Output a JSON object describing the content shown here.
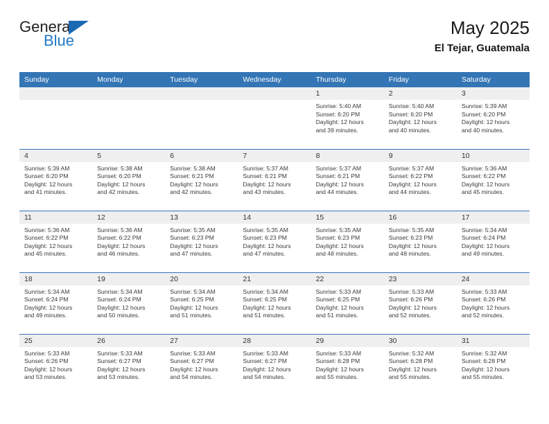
{
  "logo": {
    "word1": "General",
    "word2": "Blue",
    "triangle_color": "#1b69b3",
    "text_color": "#231f20",
    "blue_text_color": "#2079c4"
  },
  "header": {
    "title": "May 2025",
    "location": "El Tejar, Guatemala"
  },
  "theme": {
    "header_blue": "#3375b5",
    "daynum_bg": "#efefef",
    "body_text": "#3a3a3a"
  },
  "weekdays": [
    "Sunday",
    "Monday",
    "Tuesday",
    "Wednesday",
    "Thursday",
    "Friday",
    "Saturday"
  ],
  "weeks": [
    [
      {
        "day": "",
        "empty": true,
        "sunrise": "",
        "sunset": "",
        "daylight1": "",
        "daylight2": ""
      },
      {
        "day": "",
        "empty": true,
        "sunrise": "",
        "sunset": "",
        "daylight1": "",
        "daylight2": ""
      },
      {
        "day": "",
        "empty": true,
        "sunrise": "",
        "sunset": "",
        "daylight1": "",
        "daylight2": ""
      },
      {
        "day": "",
        "empty": true,
        "sunrise": "",
        "sunset": "",
        "daylight1": "",
        "daylight2": ""
      },
      {
        "day": "1",
        "sunrise": "Sunrise: 5:40 AM",
        "sunset": "Sunset: 6:20 PM",
        "daylight1": "Daylight: 12 hours",
        "daylight2": "and 39 minutes."
      },
      {
        "day": "2",
        "sunrise": "Sunrise: 5:40 AM",
        "sunset": "Sunset: 6:20 PM",
        "daylight1": "Daylight: 12 hours",
        "daylight2": "and 40 minutes."
      },
      {
        "day": "3",
        "sunrise": "Sunrise: 5:39 AM",
        "sunset": "Sunset: 6:20 PM",
        "daylight1": "Daylight: 12 hours",
        "daylight2": "and 40 minutes."
      }
    ],
    [
      {
        "day": "4",
        "sunrise": "Sunrise: 5:39 AM",
        "sunset": "Sunset: 6:20 PM",
        "daylight1": "Daylight: 12 hours",
        "daylight2": "and 41 minutes."
      },
      {
        "day": "5",
        "sunrise": "Sunrise: 5:38 AM",
        "sunset": "Sunset: 6:20 PM",
        "daylight1": "Daylight: 12 hours",
        "daylight2": "and 42 minutes."
      },
      {
        "day": "6",
        "sunrise": "Sunrise: 5:38 AM",
        "sunset": "Sunset: 6:21 PM",
        "daylight1": "Daylight: 12 hours",
        "daylight2": "and 42 minutes."
      },
      {
        "day": "7",
        "sunrise": "Sunrise: 5:37 AM",
        "sunset": "Sunset: 6:21 PM",
        "daylight1": "Daylight: 12 hours",
        "daylight2": "and 43 minutes."
      },
      {
        "day": "8",
        "sunrise": "Sunrise: 5:37 AM",
        "sunset": "Sunset: 6:21 PM",
        "daylight1": "Daylight: 12 hours",
        "daylight2": "and 44 minutes."
      },
      {
        "day": "9",
        "sunrise": "Sunrise: 5:37 AM",
        "sunset": "Sunset: 6:22 PM",
        "daylight1": "Daylight: 12 hours",
        "daylight2": "and 44 minutes."
      },
      {
        "day": "10",
        "sunrise": "Sunrise: 5:36 AM",
        "sunset": "Sunset: 6:22 PM",
        "daylight1": "Daylight: 12 hours",
        "daylight2": "and 45 minutes."
      }
    ],
    [
      {
        "day": "11",
        "sunrise": "Sunrise: 5:36 AM",
        "sunset": "Sunset: 6:22 PM",
        "daylight1": "Daylight: 12 hours",
        "daylight2": "and 45 minutes."
      },
      {
        "day": "12",
        "sunrise": "Sunrise: 5:36 AM",
        "sunset": "Sunset: 6:22 PM",
        "daylight1": "Daylight: 12 hours",
        "daylight2": "and 46 minutes."
      },
      {
        "day": "13",
        "sunrise": "Sunrise: 5:35 AM",
        "sunset": "Sunset: 6:23 PM",
        "daylight1": "Daylight: 12 hours",
        "daylight2": "and 47 minutes."
      },
      {
        "day": "14",
        "sunrise": "Sunrise: 5:35 AM",
        "sunset": "Sunset: 6:23 PM",
        "daylight1": "Daylight: 12 hours",
        "daylight2": "and 47 minutes."
      },
      {
        "day": "15",
        "sunrise": "Sunrise: 5:35 AM",
        "sunset": "Sunset: 6:23 PM",
        "daylight1": "Daylight: 12 hours",
        "daylight2": "and 48 minutes."
      },
      {
        "day": "16",
        "sunrise": "Sunrise: 5:35 AM",
        "sunset": "Sunset: 6:23 PM",
        "daylight1": "Daylight: 12 hours",
        "daylight2": "and 48 minutes."
      },
      {
        "day": "17",
        "sunrise": "Sunrise: 5:34 AM",
        "sunset": "Sunset: 6:24 PM",
        "daylight1": "Daylight: 12 hours",
        "daylight2": "and 49 minutes."
      }
    ],
    [
      {
        "day": "18",
        "sunrise": "Sunrise: 5:34 AM",
        "sunset": "Sunset: 6:24 PM",
        "daylight1": "Daylight: 12 hours",
        "daylight2": "and 49 minutes."
      },
      {
        "day": "19",
        "sunrise": "Sunrise: 5:34 AM",
        "sunset": "Sunset: 6:24 PM",
        "daylight1": "Daylight: 12 hours",
        "daylight2": "and 50 minutes."
      },
      {
        "day": "20",
        "sunrise": "Sunrise: 5:34 AM",
        "sunset": "Sunset: 6:25 PM",
        "daylight1": "Daylight: 12 hours",
        "daylight2": "and 51 minutes."
      },
      {
        "day": "21",
        "sunrise": "Sunrise: 5:34 AM",
        "sunset": "Sunset: 6:25 PM",
        "daylight1": "Daylight: 12 hours",
        "daylight2": "and 51 minutes."
      },
      {
        "day": "22",
        "sunrise": "Sunrise: 5:33 AM",
        "sunset": "Sunset: 6:25 PM",
        "daylight1": "Daylight: 12 hours",
        "daylight2": "and 51 minutes."
      },
      {
        "day": "23",
        "sunrise": "Sunrise: 5:33 AM",
        "sunset": "Sunset: 6:26 PM",
        "daylight1": "Daylight: 12 hours",
        "daylight2": "and 52 minutes."
      },
      {
        "day": "24",
        "sunrise": "Sunrise: 5:33 AM",
        "sunset": "Sunset: 6:26 PM",
        "daylight1": "Daylight: 12 hours",
        "daylight2": "and 52 minutes."
      }
    ],
    [
      {
        "day": "25",
        "sunrise": "Sunrise: 5:33 AM",
        "sunset": "Sunset: 6:26 PM",
        "daylight1": "Daylight: 12 hours",
        "daylight2": "and 53 minutes."
      },
      {
        "day": "26",
        "sunrise": "Sunrise: 5:33 AM",
        "sunset": "Sunset: 6:27 PM",
        "daylight1": "Daylight: 12 hours",
        "daylight2": "and 53 minutes."
      },
      {
        "day": "27",
        "sunrise": "Sunrise: 5:33 AM",
        "sunset": "Sunset: 6:27 PM",
        "daylight1": "Daylight: 12 hours",
        "daylight2": "and 54 minutes."
      },
      {
        "day": "28",
        "sunrise": "Sunrise: 5:33 AM",
        "sunset": "Sunset: 6:27 PM",
        "daylight1": "Daylight: 12 hours",
        "daylight2": "and 54 minutes."
      },
      {
        "day": "29",
        "sunrise": "Sunrise: 5:33 AM",
        "sunset": "Sunset: 6:28 PM",
        "daylight1": "Daylight: 12 hours",
        "daylight2": "and 55 minutes."
      },
      {
        "day": "30",
        "sunrise": "Sunrise: 5:32 AM",
        "sunset": "Sunset: 6:28 PM",
        "daylight1": "Daylight: 12 hours",
        "daylight2": "and 55 minutes."
      },
      {
        "day": "31",
        "sunrise": "Sunrise: 5:32 AM",
        "sunset": "Sunset: 6:28 PM",
        "daylight1": "Daylight: 12 hours",
        "daylight2": "and 55 minutes."
      }
    ]
  ]
}
